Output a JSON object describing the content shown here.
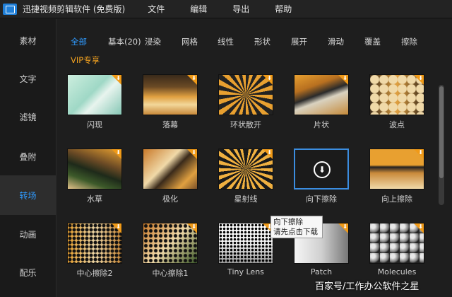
{
  "app": {
    "title": "迅捷视频剪辑软件 (免费版)",
    "menu": [
      "文件",
      "编辑",
      "导出",
      "帮助"
    ]
  },
  "sidebar": {
    "items": [
      {
        "label": "素材"
      },
      {
        "label": "文字"
      },
      {
        "label": "滤镜"
      },
      {
        "label": "叠附"
      },
      {
        "label": "转场",
        "active": true
      },
      {
        "label": "动画"
      },
      {
        "label": "配乐"
      }
    ]
  },
  "tabs": [
    {
      "label": "全部",
      "active": true
    },
    {
      "label": "基本(20)"
    },
    {
      "label": "浸染"
    },
    {
      "label": "网格"
    },
    {
      "label": "线性"
    },
    {
      "label": "形状"
    },
    {
      "label": "展开"
    },
    {
      "label": "滑动"
    },
    {
      "label": "覆盖"
    },
    {
      "label": "擦除"
    }
  ],
  "vip_label": "VIP专享",
  "transitions": [
    {
      "label": "闪现"
    },
    {
      "label": "落幕"
    },
    {
      "label": "环状散开"
    },
    {
      "label": "片状"
    },
    {
      "label": "波点"
    },
    {
      "label": "水草"
    },
    {
      "label": "极化"
    },
    {
      "label": "星射线"
    },
    {
      "label": "向下擦除",
      "hover": true
    },
    {
      "label": "向上擦除"
    },
    {
      "label": "中心擦除2"
    },
    {
      "label": "中心擦除1"
    },
    {
      "label": "Tiny Lens"
    },
    {
      "label": "Patch"
    },
    {
      "label": "Molecules"
    }
  ],
  "tooltip": {
    "line1": "向下擦除",
    "line2": "请先点击下载"
  },
  "watermark": "百家号/工作办公软件之星",
  "colors": {
    "accent": "#2f9bff",
    "vip": "#f0a020",
    "download_badge": "#f09a18"
  },
  "icons": {
    "download": "download-icon"
  }
}
